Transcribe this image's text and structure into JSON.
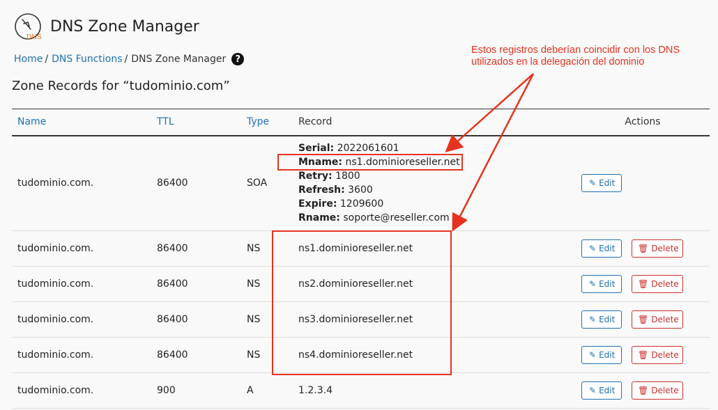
{
  "header": {
    "title": "DNS Zone Manager",
    "logo_text": "DNS"
  },
  "breadcrumb": {
    "home": "Home",
    "dns_functions": "DNS Functions",
    "current": "DNS Zone Manager",
    "separator": "/",
    "help": "?"
  },
  "zone_title": "Zone Records for “tudominio.com”",
  "table": {
    "headers": {
      "name": "Name",
      "ttl": "TTL",
      "type": "Type",
      "record": "Record",
      "actions": "Actions"
    },
    "soa": {
      "name": "tudominio.com.",
      "ttl": "86400",
      "type": "SOA",
      "serial_label": "Serial:",
      "serial": "2022061601",
      "mname_label": "Mname:",
      "mname": "ns1.dominioreseller.net",
      "retry_label": "Retry:",
      "retry": "1800",
      "refresh_label": "Refresh:",
      "refresh": "3600",
      "expire_label": "Expire:",
      "expire": "1209600",
      "rname_label": "Rname:",
      "rname": "soporte@reseller.com"
    },
    "rows": [
      {
        "name": "tudominio.com.",
        "ttl": "86400",
        "type": "NS",
        "record": "ns1.dominioreseller.net"
      },
      {
        "name": "tudominio.com.",
        "ttl": "86400",
        "type": "NS",
        "record": "ns2.dominioreseller.net"
      },
      {
        "name": "tudominio.com.",
        "ttl": "86400",
        "type": "NS",
        "record": "ns3.dominioreseller.net"
      },
      {
        "name": "tudominio.com.",
        "ttl": "86400",
        "type": "NS",
        "record": "ns4.dominioreseller.net"
      },
      {
        "name": "tudominio.com.",
        "ttl": "900",
        "type": "A",
        "record": "1.2.3.4"
      }
    ]
  },
  "buttons": {
    "edit": "Edit",
    "delete": "Delete"
  },
  "annotation": {
    "text": "Estos registros deberían coincidir con los DNS utilizados en la delegación del dominio",
    "color": "#e6321e"
  },
  "colors": {
    "link": "#1e6fb5",
    "danger": "#c9302c",
    "accent": "#f36c21"
  }
}
